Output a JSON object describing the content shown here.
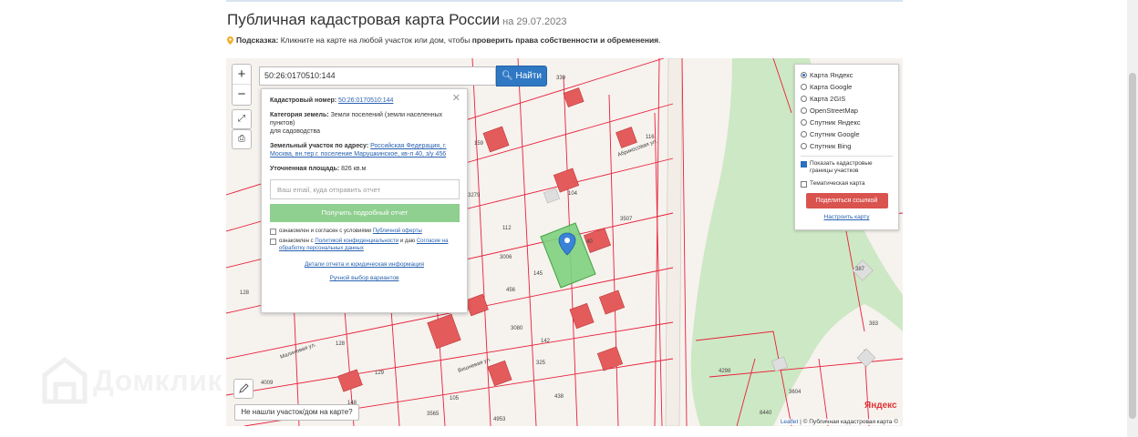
{
  "page": {
    "title": "Публичная кадастровая карта России",
    "date": "на 29.07.2023",
    "hint_prefix": "Подсказка:",
    "hint_text": "Кликните на карте на любой участок или дом, чтобы",
    "hint_bold": "проверить права собственности и обременения",
    "hint_end": "."
  },
  "search": {
    "value": "50:26:0170510:144",
    "button": "Найти"
  },
  "popup": {
    "cad_label": "Кадастровый номер:",
    "cad_value": "50:26:0170510:144",
    "category_label": "Категория земель:",
    "category_value": "Земли поселений (земли населенных пунктов)",
    "category_sub": "для садоводства",
    "address_label": "Земельный участок по адресу:",
    "address_value": "Российская Федерация, г. Москва, вн.тер.г. поселение Марушкинское, кв-л 40, з/у 456",
    "area_label": "Уточненная площадь:",
    "area_value": "826 кв.м",
    "email_placeholder": "Ваш email, куда отправить отчет",
    "report_button": "Получить подробный отчет",
    "consent1_prefix": "ознакомлен и согласен с условиями",
    "consent1_link": "Публичной оферты",
    "consent2_prefix": "ознакомлен с",
    "consent2_link": "Политикой конфиденциальности",
    "consent2_suffix": "и даю",
    "consent2_link2": "Согласие на обработку персональных данных",
    "details_link": "Детали отчета и юридическая информация",
    "manual_link": "Ручной выбор вариантов"
  },
  "layers": {
    "options": [
      "Карта Яндекс",
      "Карта Google",
      "Карта 2GIS",
      "OpenStreetMap",
      "Спутник Яндекс",
      "Спутник Google",
      "Спутник Bing"
    ],
    "selected_index": 0,
    "show_borders": "Показать кадастровые границы участков",
    "thematic": "Тематическая карта",
    "share": "Поделиться ссылкой",
    "setup": "Настроить карту"
  },
  "map": {
    "not_found": "Не нашли участок/дом на карте?",
    "attrib_leaflet": "Leaflet",
    "attrib_text": "| © Публичная кадастровая карта ©",
    "yandex": "Яндекс",
    "street1": "Абрикосовая ул.",
    "street2": "Вишневая ул.",
    "street3": "Малиновая ул.",
    "labels": [
      "159",
      "339",
      "116",
      "104",
      "3279",
      "145",
      "456",
      "112",
      "3507",
      "3006",
      "4009",
      "128",
      "148",
      "129",
      "142",
      "3080",
      "438",
      "3565",
      "4953",
      "4298",
      "387",
      "383",
      "3604",
      "8440",
      "128",
      "325",
      "105",
      "40"
    ]
  },
  "watermark": "Домклик",
  "colors": {
    "accent": "#2f78c4",
    "parcel": "#e23a3a",
    "selected": "#7ed17e",
    "forest": "#cde8c4",
    "share": "#d9534f"
  }
}
